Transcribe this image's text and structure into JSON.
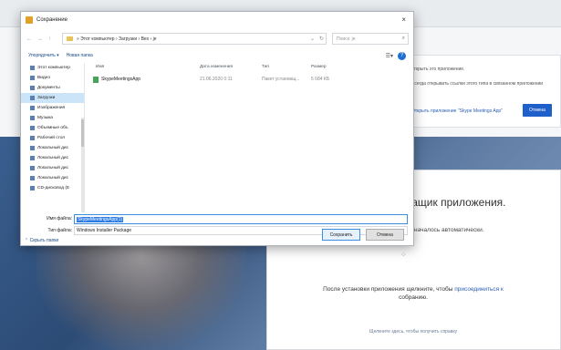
{
  "window": {
    "title": "Сохранение",
    "close_icon": "×"
  },
  "nav": {
    "back": "←",
    "forward": "→",
    "up": "↑",
    "breadcrumb": "» Этот компьютер › Загрузки › Bex › je",
    "search_placeholder": "Поиск: je"
  },
  "toolbar": {
    "organize": "Упорядочить ▾",
    "new_folder": "Новая папка",
    "help": "?"
  },
  "sidebar": {
    "items": [
      {
        "label": "Этот компьютер",
        "selected": false
      },
      {
        "label": "Видео",
        "selected": false
      },
      {
        "label": "Документы",
        "selected": false
      },
      {
        "label": "Загрузки",
        "selected": true
      },
      {
        "label": "Изображения",
        "selected": false
      },
      {
        "label": "Музыка",
        "selected": false
      },
      {
        "label": "Объемные объ",
        "selected": false
      },
      {
        "label": "Рабочий стол",
        "selected": false
      },
      {
        "label": "Локальный дис",
        "selected": false
      },
      {
        "label": "Локальный дис",
        "selected": false
      },
      {
        "label": "Локальный дис",
        "selected": false
      },
      {
        "label": "Локальный дис",
        "selected": false
      },
      {
        "label": "CD-дисковод (E",
        "selected": false
      }
    ]
  },
  "columns": {
    "name": "Имя",
    "date": "Дата изменения",
    "type": "Тип",
    "size": "Размер"
  },
  "files": [
    {
      "name": "SkypeMeetingsApp",
      "date": "21.06.2020 0:11",
      "type": "Пакет установщ...",
      "size": "5 684 КБ"
    }
  ],
  "file_name": {
    "label": "Имя файла:",
    "value": "SkypeMeetingsApp(1)"
  },
  "file_type": {
    "label": "Тип файла:",
    "value": "Windows Installer Package"
  },
  "bottom": {
    "hide_folders": "⌃ Скрыть папки",
    "save": "Сохранить",
    "cancel": "Отмена"
  },
  "background": {
    "prompt_line1": "открыть это приложение.",
    "prompt_line2": "Всегда открывать ссылки этого типа в связанном приложении",
    "prompt_link": "Открыть приложение \"Skype Meetings App\"",
    "prompt_button": "Отмена",
    "card_title": "ващик приложения.",
    "card_subtitle": "не началось автоматически.",
    "card_body_before": "После установки приложения щелкните, чтобы ",
    "card_body_link": "присоединиться к",
    "card_body_after": "собранию.",
    "card_footer": "Щелкните здесь, чтобы получить справку"
  }
}
